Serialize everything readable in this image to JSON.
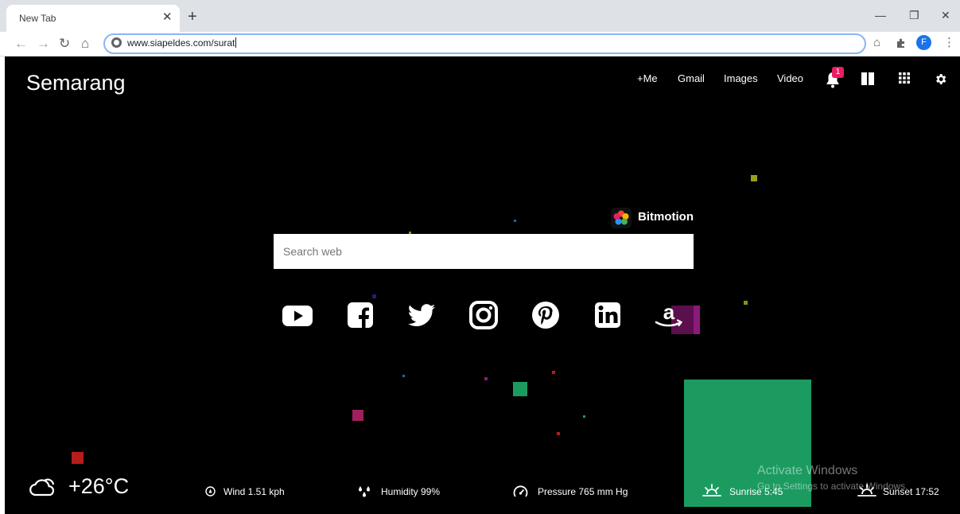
{
  "browser": {
    "tab_title": "New Tab",
    "tab_close": "✕",
    "new_tab": "+",
    "url": "www.siapeldes.com/surat",
    "profile_initial": "F",
    "win_min": "—",
    "win_restore": "❐",
    "win_close": "✕"
  },
  "page": {
    "city": "Semarang",
    "nav": {
      "me": "+Me",
      "gmail": "Gmail",
      "images": "Images",
      "video": "Video",
      "notification_count": "1"
    },
    "promo_name": "Bitmotion",
    "search_placeholder": "Search web",
    "social_links": [
      "youtube-link",
      "facebook-link",
      "twitter-link",
      "instagram-link",
      "pinterest-link",
      "linkedin-link",
      "amazon-link"
    ],
    "weather": {
      "temperature": "+26°C",
      "wind": "Wind 1.51 kph",
      "humidity": "Humidity 99%",
      "pressure": "Pressure 765 mm Hg",
      "sunrise": "Sunrise 5:45",
      "sunset": "Sunset 17:52"
    },
    "watermark": {
      "line1": "Activate Windows",
      "line2": "Go to Settings to activate Windows."
    }
  },
  "colors": {
    "page_bg": "#000000",
    "accent_green": "#1c9b61",
    "badge": "#e91e63",
    "omnibox_focus": "#8ab4f8"
  }
}
